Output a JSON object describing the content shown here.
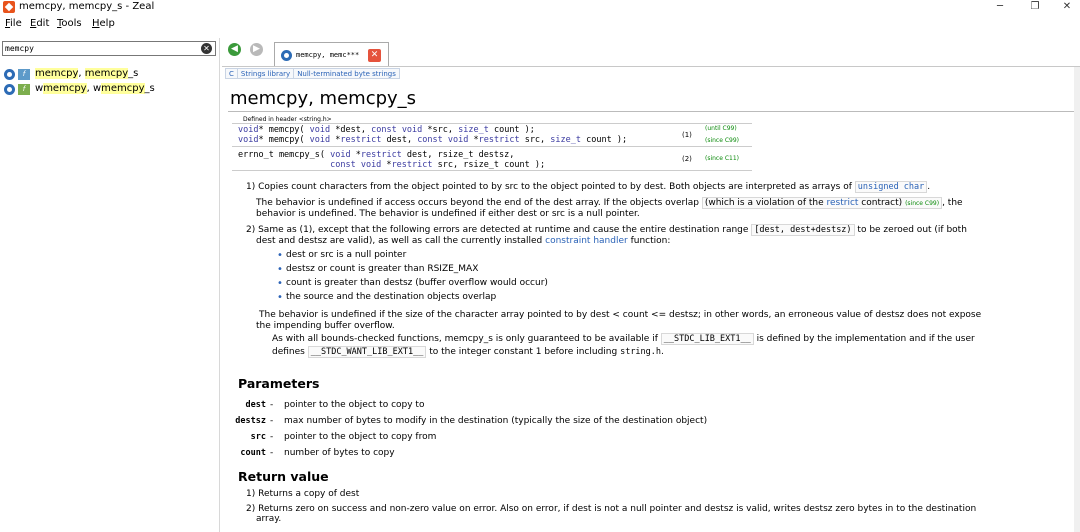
{
  "window": {
    "title": "memcpy, memcpy_s - Zeal",
    "minimize": "─",
    "maximize": "❐",
    "close": "✕"
  },
  "menu": [
    {
      "first": "F",
      "rest": "ile"
    },
    {
      "first": "E",
      "rest": "dit"
    },
    {
      "first": "T",
      "rest": "ools"
    },
    {
      "first": "H",
      "rest": "elp"
    }
  ],
  "search": {
    "value": "memcpy",
    "clear": "✕"
  },
  "results": [
    {
      "pre": "",
      "match": "memcpy",
      "post": ", ",
      "match2": "memcpy",
      "post2": "_s",
      "icon2": "f",
      "icon2_color": "blue"
    },
    {
      "pre": "w",
      "match": "memcpy",
      "post": ", w",
      "match2": "memcpy",
      "post2": "_s",
      "icon2": "f",
      "icon2_color": "green"
    }
  ],
  "nav": {
    "back": "◀",
    "forward": "▶"
  },
  "tab": {
    "label": "memcpy, memc***",
    "close": "✕"
  },
  "breadcrumbs": [
    "C",
    "Strings library",
    "Null-terminated byte strings"
  ],
  "page_title": "memcpy, memcpy_s",
  "header_def": "Defined in header <string.h>",
  "decl": {
    "r1": {
      "num": "(1)",
      "ver1": "(until C99)",
      "ver2": "(since C99)"
    },
    "r2": {
      "num": "(2)",
      "ver": "(since C11)"
    }
  },
  "p1": {
    "a": "1) Copies count characters from the object pointed to by src to the object pointed to by dest. Both objects are interpreted as arrays of",
    "code": "unsigned char",
    "b": "."
  },
  "p1b": {
    "a": "The behavior is undefined if access occurs beyond the end of the dest array. If the objects overlap",
    "box": "(which is a violation of the ",
    "kw": "restrict",
    "box2": " contract)",
    "since": "(since C99)",
    "b": ", the",
    "line2": "behavior is undefined. The behavior is undefined if either dest or src is a null pointer."
  },
  "p2": {
    "a": "2) Same as (1), except that the following errors are detected at runtime and cause the entire destination range",
    "code": "[dest, dest+destsz)",
    "b": "to be zeroed out (if both",
    "line2a": "dest and destsz are valid), as well as call the currently installed",
    "link": "constraint handler",
    "line2b": "function:"
  },
  "bullets": [
    "dest or src is a null pointer",
    "destsz or count is greater than RSIZE_MAX",
    "count is greater than destsz (buffer overflow would occur)",
    "the source and the destination objects overlap"
  ],
  "p3": {
    "line1": "The behavior is undefined if the size of the character array pointed to by dest < count <= destsz; in other words, an erroneous value of destsz does not expose",
    "line2": "the impending buffer overflow."
  },
  "p4": {
    "a": "As with all bounds-checked functions, memcpy_s is only guaranteed to be available if",
    "code1": "__STDC_LIB_EXT1__",
    "b": "is defined by the implementation and if the user",
    "c": "defines",
    "code2": "__STDC_WANT_LIB_EXT1__",
    "d": "to the integer constant 1 before including",
    "code3": "string.h",
    "e": "."
  },
  "params_title": "Parameters",
  "params": [
    {
      "name": "dest",
      "dash": "-",
      "desc": "pointer to the object to copy to"
    },
    {
      "name": "destsz",
      "dash": "-",
      "desc": "max number of bytes to modify in the destination (typically the size of the destination object)"
    },
    {
      "name": "src",
      "dash": "-",
      "desc": "pointer to the object to copy from"
    },
    {
      "name": "count",
      "dash": "-",
      "desc": "number of bytes to copy"
    }
  ],
  "return_title": "Return value",
  "returns": {
    "r1": "1) Returns a copy of dest",
    "r2a": "2) Returns zero on success and non-zero value on error. Also on error, if dest is not a null pointer and destsz is valid, writes destsz zero bytes in to the destination",
    "r2b": "array."
  }
}
